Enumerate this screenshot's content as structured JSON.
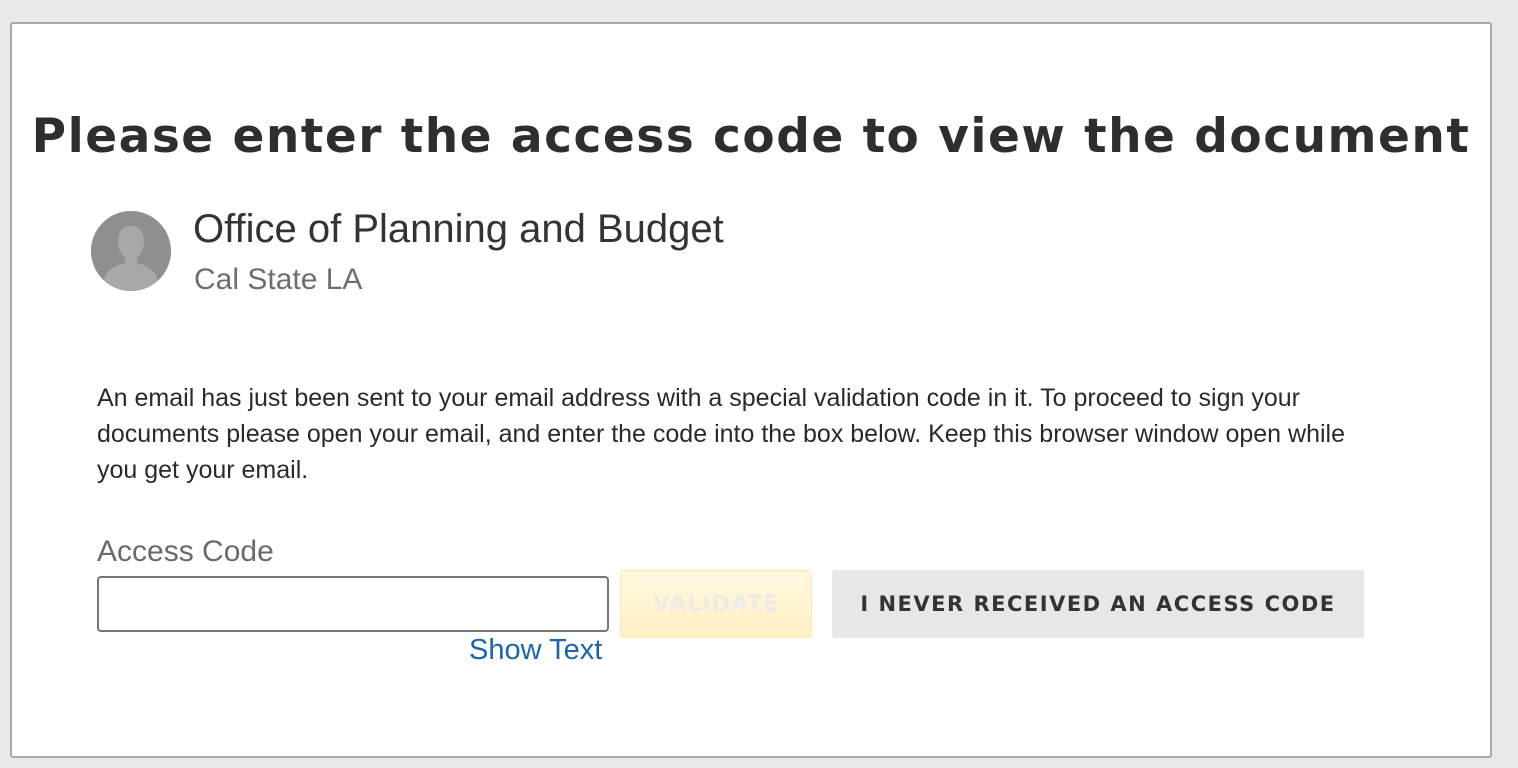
{
  "page": {
    "title": "Please enter the access code to view the document"
  },
  "sender": {
    "name": "Office of Planning and Budget",
    "organization": "Cal State LA",
    "avatar_icon": "user-silhouette-icon"
  },
  "message": "An email has just been sent to your email address with a special validation code in it. To proceed to sign your documents please open your email, and enter the code into the box below. Keep this browser window open while you get your email.",
  "form": {
    "access_code_label": "Access Code",
    "access_code_value": "",
    "validate_label": "VALIDATE",
    "show_text_label": "Show Text",
    "no_code_label": "I NEVER RECEIVED AN ACCESS CODE"
  },
  "colors": {
    "background": "#e9e9e9",
    "card": "#ffffff",
    "title_text": "#2e2e2e",
    "link": "#1a66b0",
    "validate_button_disabled": "#fff0c4",
    "secondary_button": "#e7e7e7",
    "avatar": "#8f8f8f"
  }
}
